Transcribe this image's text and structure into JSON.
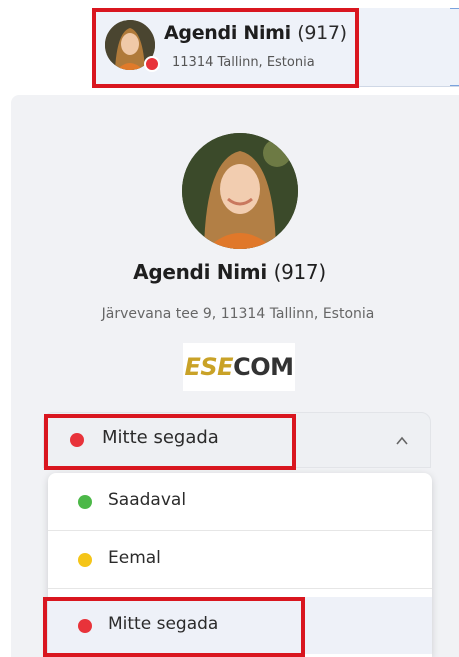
{
  "header": {
    "name": "Agendi Nimi",
    "extension": "(917)",
    "address": "11314 Tallinn, Estonia",
    "status_color": "#e8333a"
  },
  "profile": {
    "name": "Agendi Nimi",
    "extension": "(917)",
    "address": "Järvevana tee 9, 11314 Tallinn, Estonia",
    "logo": {
      "part1": "ESE",
      "part2": "COM",
      "accent": "#c9a227"
    }
  },
  "status_selector": {
    "current": "Mitte segada",
    "current_color": "#e8333a",
    "icon": "chevron-up-icon"
  },
  "status_options": [
    {
      "label": "Saadaval",
      "color": "#4cb848"
    },
    {
      "label": "Eemal",
      "color": "#f5c518"
    },
    {
      "label": "Mitte segada",
      "color": "#e8333a",
      "selected": true
    }
  ],
  "highlight_color": "#d9161f"
}
